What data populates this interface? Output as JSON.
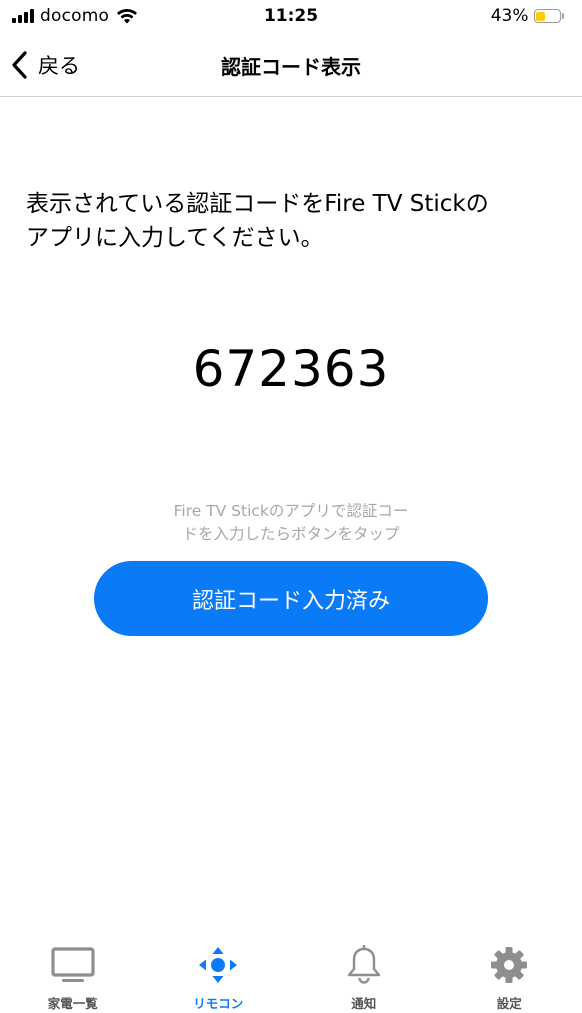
{
  "status_bar": {
    "carrier": "docomo",
    "time": "11:25",
    "battery_percent": "43%",
    "battery_level": 0.43,
    "battery_color": "#ffcc00"
  },
  "nav": {
    "back_label": "戻る",
    "title": "認証コード表示"
  },
  "main": {
    "instruction_line1": "表示されている認証コードをFire TV Stickの",
    "instruction_line2": "アプリに入力してください。",
    "code": "672363",
    "hint_line1": "Fire TV Stickのアプリで認証コー",
    "hint_line2": "ドを入力したらボタンをタップ",
    "confirm_button": "認証コード入力済み"
  },
  "tabs": [
    {
      "label": "家電一覧",
      "icon": "tv-icon",
      "active": false
    },
    {
      "label": "リモコン",
      "icon": "remote-dpad-icon",
      "active": true
    },
    {
      "label": "通知",
      "icon": "bell-icon",
      "active": false
    },
    {
      "label": "設定",
      "icon": "gear-icon",
      "active": false
    }
  ],
  "colors": {
    "accent": "#0a7af7",
    "hint_text": "#a8a8a8",
    "inactive_icon": "#8e8e8e"
  }
}
